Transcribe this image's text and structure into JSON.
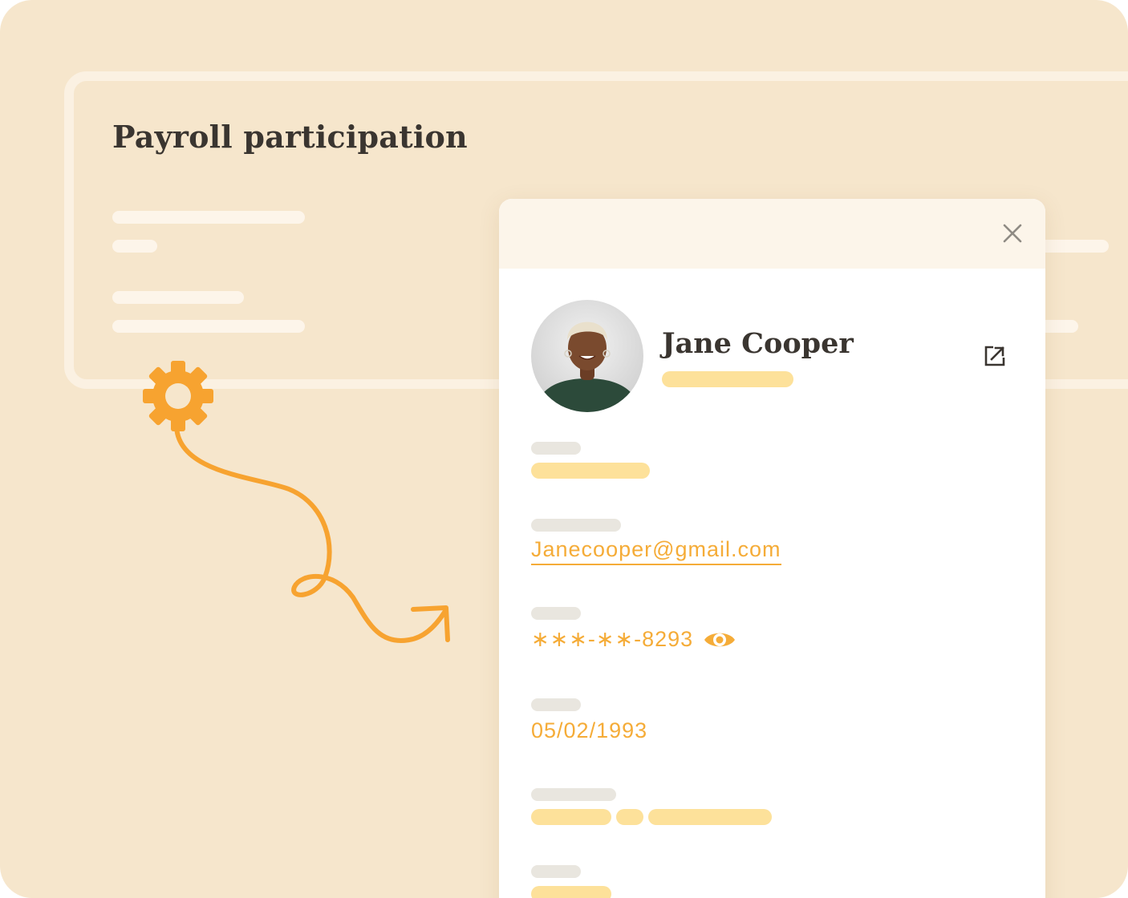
{
  "page": {
    "title": "Payroll participation"
  },
  "profile": {
    "name": "Jane Cooper",
    "email": "Janecooper@gmail.com",
    "ssn": "∗∗∗-∗∗-8293",
    "dob": "05/02/1993"
  },
  "icons": {
    "close": "close-icon",
    "external": "external-link-icon",
    "eye": "eye-icon",
    "gear": "gear-icon",
    "arrow": "curly-arrow-icon"
  },
  "colors": {
    "background": "#f6e6cc",
    "accent": "#f5ac38",
    "accent_soft": "#fde19a",
    "orange": "#f7a330",
    "text_dark": "#3a3530"
  }
}
